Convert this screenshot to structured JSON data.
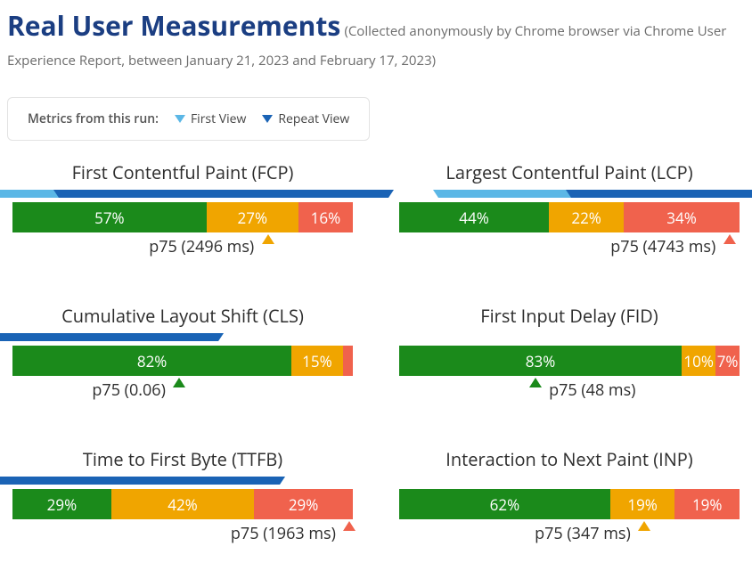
{
  "header": {
    "title": "Real User Measurements",
    "subtitle": "(Collected anonymously by Chrome browser via Chrome User Experience Report, between January 21, 2023 and February 17, 2023)"
  },
  "legend": {
    "label": "Metrics from this run:",
    "first_view": "First View",
    "repeat_view": "Repeat View"
  },
  "chart_data": [
    {
      "title": "First Contentful Paint (FCP)",
      "type": "bar",
      "segments": [
        {
          "label": "57%",
          "value": 57,
          "class": "good"
        },
        {
          "label": "27%",
          "value": 27,
          "class": "mid"
        },
        {
          "label": "16%",
          "value": 16,
          "class": "bad"
        }
      ],
      "markers": {
        "first_view_pct": 40,
        "repeat_view_pct": 62
      },
      "p75": {
        "text": "p75 (2496 ms)",
        "pos_pct": 75,
        "color": "orange",
        "text_side": "left"
      }
    },
    {
      "title": "Largest Contentful Paint (LCP)",
      "type": "bar",
      "segments": [
        {
          "label": "44%",
          "value": 44,
          "class": "good"
        },
        {
          "label": "22%",
          "value": 22,
          "class": "mid"
        },
        {
          "label": "34%",
          "value": 34,
          "class": "bad"
        }
      ],
      "markers": {
        "first_view_pct": 60,
        "repeat_view_pct": 99
      },
      "p75": {
        "text": "p75 (4743 ms)",
        "pos_pct": 97,
        "color": "red",
        "text_side": "left"
      }
    },
    {
      "title": "Cumulative Layout Shift (CLS)",
      "type": "bar",
      "segments": [
        {
          "label": "82%",
          "value": 82,
          "class": "good"
        },
        {
          "label": "15%",
          "value": 15,
          "class": "mid"
        },
        {
          "label": "",
          "value": 3,
          "class": "bad"
        }
      ],
      "markers": {
        "first_view_pct": 12,
        "repeat_view_pct": 12
      },
      "p75": {
        "text": "p75 (0.06)",
        "pos_pct": 49,
        "color": "green",
        "text_side": "left"
      }
    },
    {
      "title": "First Input Delay (FID)",
      "type": "bar",
      "segments": [
        {
          "label": "83%",
          "value": 83,
          "class": "good"
        },
        {
          "label": "10%",
          "value": 10,
          "class": "mid"
        },
        {
          "label": "7%",
          "value": 7,
          "class": "bad"
        }
      ],
      "markers": {},
      "p75": {
        "text": "p75 (48 ms)",
        "pos_pct": 40,
        "color": "green",
        "text_side": "right"
      }
    },
    {
      "title": "Time to First Byte (TTFB)",
      "type": "bar",
      "segments": [
        {
          "label": "29%",
          "value": 29,
          "class": "good"
        },
        {
          "label": "42%",
          "value": 42,
          "class": "mid"
        },
        {
          "label": "29%",
          "value": 29,
          "class": "bad"
        }
      ],
      "markers": {
        "first_view_pct": 30,
        "repeat_view_pct": 30
      },
      "p75": {
        "text": "p75 (1963 ms)",
        "pos_pct": 99,
        "color": "red",
        "text_side": "left"
      }
    },
    {
      "title": "Interaction to Next Paint (INP)",
      "type": "bar",
      "segments": [
        {
          "label": "62%",
          "value": 62,
          "class": "good"
        },
        {
          "label": "19%",
          "value": 19,
          "class": "mid"
        },
        {
          "label": "19%",
          "value": 19,
          "class": "bad"
        }
      ],
      "markers": {},
      "p75": {
        "text": "p75 (347 ms)",
        "pos_pct": 72,
        "color": "orange",
        "text_side": "left"
      }
    }
  ]
}
